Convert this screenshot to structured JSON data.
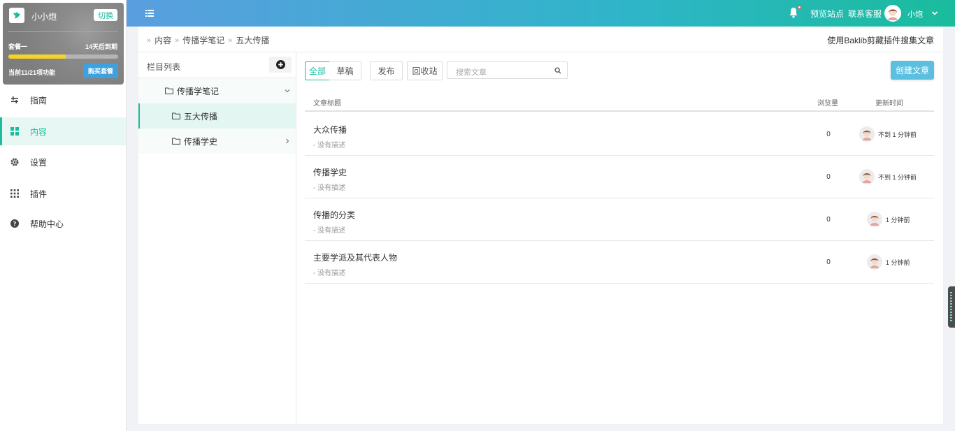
{
  "sidebar": {
    "account": {
      "name": "小小炮",
      "switch_label": "切换",
      "plan_name": "套餐一",
      "expire_text": "14天后到期",
      "usage_text": "当前11/21项功能",
      "buy_label": "购买套餐",
      "progress": 0.52,
      "colors": {
        "progress": "#f5d327",
        "buy": "#3fa0de"
      }
    },
    "items": [
      {
        "label": "指南",
        "icon": "sliders-icon"
      },
      {
        "label": "内容",
        "icon": "grid-icon",
        "active": true
      },
      {
        "label": "设置",
        "icon": "gear-icon"
      },
      {
        "label": "插件",
        "icon": "dots-grid-icon"
      },
      {
        "label": "帮助中心",
        "icon": "question-circle-icon"
      }
    ]
  },
  "header": {
    "preview_label": "预览站点",
    "support_label": "联系客服",
    "user_name": "小炮",
    "colors": {
      "gradient_start": "#5a9ee0",
      "gradient_end": "#1abc9c"
    }
  },
  "breadcrumb": [
    "内容",
    "传播学笔记",
    "五大传播"
  ],
  "clip_link": "使用Baklib剪藏插件搜集文章",
  "tree": {
    "title": "栏目列表",
    "nodes": [
      {
        "label": "传播学笔记"
      },
      {
        "label": "五大传播"
      },
      {
        "label": "传播学史"
      }
    ]
  },
  "filters": [
    "全部",
    "草稿",
    "发布",
    "回收站"
  ],
  "search": {
    "placeholder": "搜索文章"
  },
  "create_label": "创建文章",
  "table": {
    "headers": {
      "title": "文章标题",
      "views": "浏览量",
      "updated": "更新时间"
    },
    "rows": [
      {
        "title": "大众传播",
        "desc": "- 没有描述",
        "views": "0",
        "time": "不到 1 分钟前"
      },
      {
        "title": "传播学史",
        "desc": "- 没有描述",
        "views": "0",
        "time": "不到 1 分钟前"
      },
      {
        "title": "传播的分类",
        "desc": "- 没有描述",
        "views": "0",
        "time": "1 分钟前"
      },
      {
        "title": "主要学派及其代表人物",
        "desc": "- 没有描述",
        "views": "0",
        "time": "1 分钟前"
      }
    ]
  },
  "accent_color": "#1abc9c"
}
